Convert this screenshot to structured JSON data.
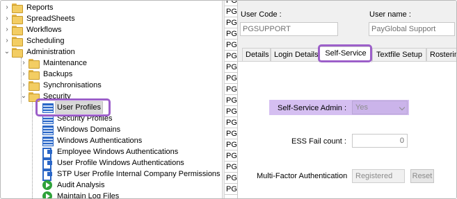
{
  "tree": {
    "top_items": [
      {
        "label": "Reports",
        "icon": "folder-icon",
        "expanded": false
      },
      {
        "label": "SpreadSheets",
        "icon": "folder-icon",
        "expanded": false
      },
      {
        "label": "Workflows",
        "icon": "folder-icon",
        "expanded": false
      },
      {
        "label": "Scheduling",
        "icon": "folder-icon",
        "expanded": false
      },
      {
        "label": "Administration",
        "icon": "folder-open-icon",
        "expanded": true
      }
    ],
    "admin_children": [
      {
        "label": "Maintenance",
        "icon": "folder-icon",
        "expanded": false
      },
      {
        "label": "Backups",
        "icon": "folder-icon",
        "expanded": false
      },
      {
        "label": "Synchronisations",
        "icon": "folder-icon",
        "expanded": false
      },
      {
        "label": "Security",
        "icon": "folder-open-icon",
        "expanded": true
      }
    ],
    "security_children": [
      {
        "label": "User Profiles",
        "icon": "form-icon",
        "selected": true
      },
      {
        "label": "Security Profiles",
        "icon": "form-icon"
      },
      {
        "label": "Windows Domains",
        "icon": "form-icon"
      },
      {
        "label": "Windows Authentications",
        "icon": "form-icon"
      },
      {
        "label": "Employee Windows Authentications",
        "icon": "user-link-icon"
      },
      {
        "label": "User Profile Windows Authentications",
        "icon": "user-link-icon"
      },
      {
        "label": "STP User Profile Internal Company Permissions",
        "icon": "user-link-icon"
      },
      {
        "label": "Audit Analysis",
        "icon": "play-icon"
      },
      {
        "label": "Maintain Log Files",
        "icon": "play-icon"
      }
    ]
  },
  "code_list": {
    "cells": [
      "PG",
      "PG",
      "PG",
      "PG",
      "PG",
      "PG",
      "PG",
      "PG",
      "PG",
      "PG",
      "PG",
      "PG",
      "PG",
      "PG",
      "PG",
      "PG",
      "PG",
      "PG"
    ]
  },
  "form": {
    "user_code_label": "User Code :",
    "user_code_value": "PGSUPPORT",
    "user_name_label": "User name :",
    "user_name_value": "PayGlobal Support",
    "tabs": [
      "Details",
      "Login Details",
      "Self-Service",
      "Textfile Setup",
      "Rosterin"
    ],
    "active_tab": "Self-Service",
    "self_service_admin_label": "Self-Service Admin :",
    "self_service_admin_value": "Yes",
    "ess_fail_count_label": "ESS Fail count :",
    "ess_fail_count_value": "0",
    "mfa_label": "Multi-Factor Authentication",
    "mfa_value": "Registered",
    "reset_label": "Reset"
  },
  "colors": {
    "highlight_outline": "#9c5fc9",
    "highlight_fill": "#d5bff1"
  }
}
